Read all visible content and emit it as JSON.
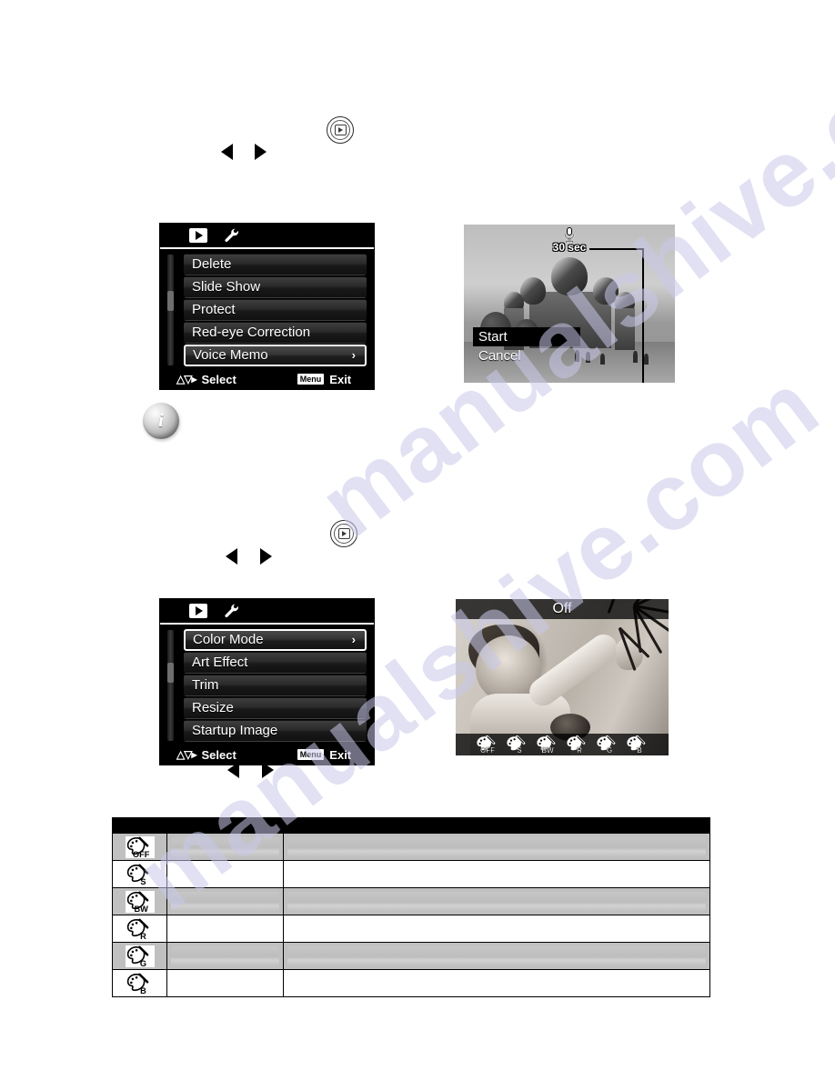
{
  "page": {
    "watermark": "manualshive.com"
  },
  "nav_hints": {
    "playback_button": "playback-button",
    "left_arrow": "left-arrow",
    "right_arrow": "right-arrow",
    "info_bullet": "i"
  },
  "voice_memo": {
    "menu": {
      "tabs": [
        {
          "name": "playback-tab",
          "icon": "play-icon"
        },
        {
          "name": "setup-tab",
          "icon": "wrench-icon"
        }
      ],
      "items": [
        {
          "label": "Delete",
          "selected": false,
          "arrow": ""
        },
        {
          "label": "Slide Show",
          "selected": false,
          "arrow": ""
        },
        {
          "label": "Protect",
          "selected": false,
          "arrow": ""
        },
        {
          "label": "Red-eye Correction",
          "selected": false,
          "arrow": ""
        },
        {
          "label": "Voice Memo",
          "selected": true,
          "arrow": "›"
        }
      ],
      "footer": {
        "select_label": "Select",
        "menu_key": "Menu",
        "exit_label": "Exit"
      }
    },
    "preview": {
      "duration_label": "30 sec",
      "mic_icon": "microphone-icon",
      "options": [
        {
          "label": "Start",
          "selected": true
        },
        {
          "label": "Cancel",
          "selected": false
        }
      ]
    }
  },
  "color_mode": {
    "menu": {
      "tabs": [
        {
          "name": "playback-tab",
          "icon": "play-icon"
        },
        {
          "name": "setup-tab",
          "icon": "wrench-icon"
        }
      ],
      "items": [
        {
          "label": "Color Mode",
          "selected": true,
          "arrow": "›"
        },
        {
          "label": "Art Effect",
          "selected": false,
          "arrow": ""
        },
        {
          "label": "Trim",
          "selected": false,
          "arrow": ""
        },
        {
          "label": "Resize",
          "selected": false,
          "arrow": ""
        },
        {
          "label": "Startup Image",
          "selected": false,
          "arrow": ""
        }
      ],
      "footer": {
        "select_label": "Select",
        "menu_key": "Menu",
        "exit_label": "Exit"
      }
    },
    "preview": {
      "title": "Off",
      "strip_icons": [
        {
          "name": "color-mode-off-icon",
          "label": "OFF"
        },
        {
          "name": "color-mode-sepia-icon",
          "label": "S"
        },
        {
          "name": "color-mode-bw-icon",
          "label": "BW"
        },
        {
          "name": "color-mode-red-icon",
          "label": "R"
        },
        {
          "name": "color-mode-green-icon",
          "label": "G"
        },
        {
          "name": "color-mode-blue-icon",
          "label": "B"
        }
      ]
    }
  },
  "color_mode_table": {
    "headers": {
      "icon": "",
      "name": "",
      "description": ""
    },
    "rows": [
      {
        "icon": "color-mode-off-icon",
        "icon_label": "OFF",
        "name": "",
        "description": "",
        "shaded": true
      },
      {
        "icon": "color-mode-sepia-icon",
        "icon_label": "S",
        "name": "",
        "description": "",
        "shaded": false
      },
      {
        "icon": "color-mode-bw-icon",
        "icon_label": "BW",
        "name": "",
        "description": "",
        "shaded": true
      },
      {
        "icon": "color-mode-red-icon",
        "icon_label": "R",
        "name": "",
        "description": "",
        "shaded": false
      },
      {
        "icon": "color-mode-green-icon",
        "icon_label": "G",
        "name": "",
        "description": "",
        "shaded": true
      },
      {
        "icon": "color-mode-blue-icon",
        "icon_label": "B",
        "name": "",
        "description": "",
        "shaded": false
      }
    ]
  },
  "colors": {
    "osd_background": "#000000",
    "osd_text": "#ffffff",
    "table_shade": "#c0c0c0",
    "watermark": "#c9c9ea"
  }
}
